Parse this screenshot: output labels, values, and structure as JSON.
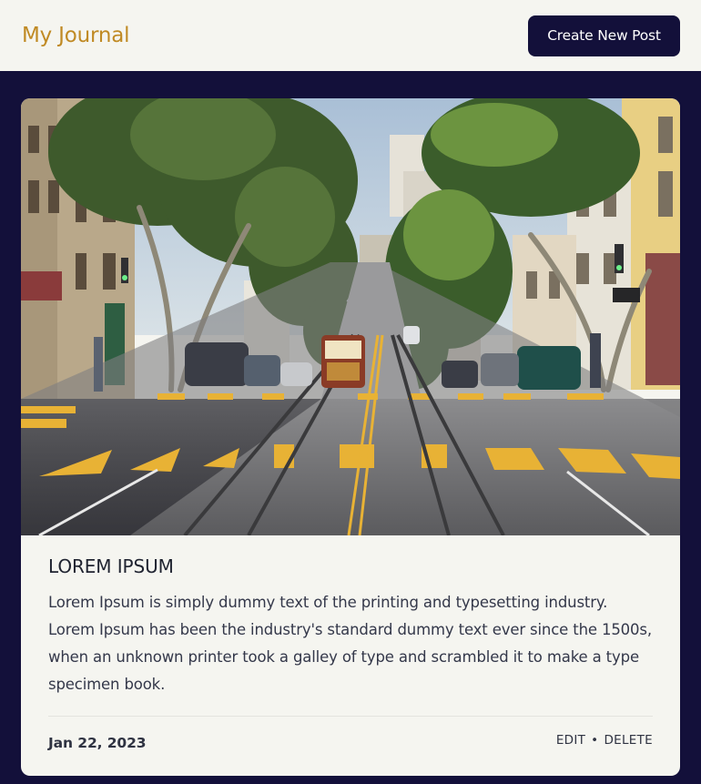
{
  "header": {
    "brand": "My Journal",
    "create_label": "Create New Post"
  },
  "post": {
    "image_alt": "Street with cable car tracks running up a steep hill between tree-lined sidewalks",
    "title": "LOREM IPSUM",
    "body": "Lorem Ipsum is simply dummy text of the printing and typesetting industry. Lorem Ipsum has been the industry's standard dummy text ever since the 1500s, when an unknown printer took a galley of type and scrambled it to make a type specimen book.",
    "date": "Jan 22, 2023",
    "edit_label": "EDIT",
    "separator": "•",
    "delete_label": "DELETE"
  },
  "colors": {
    "brand": "#c08a24",
    "navy": "#13103a",
    "surface": "#f5f5f0"
  }
}
